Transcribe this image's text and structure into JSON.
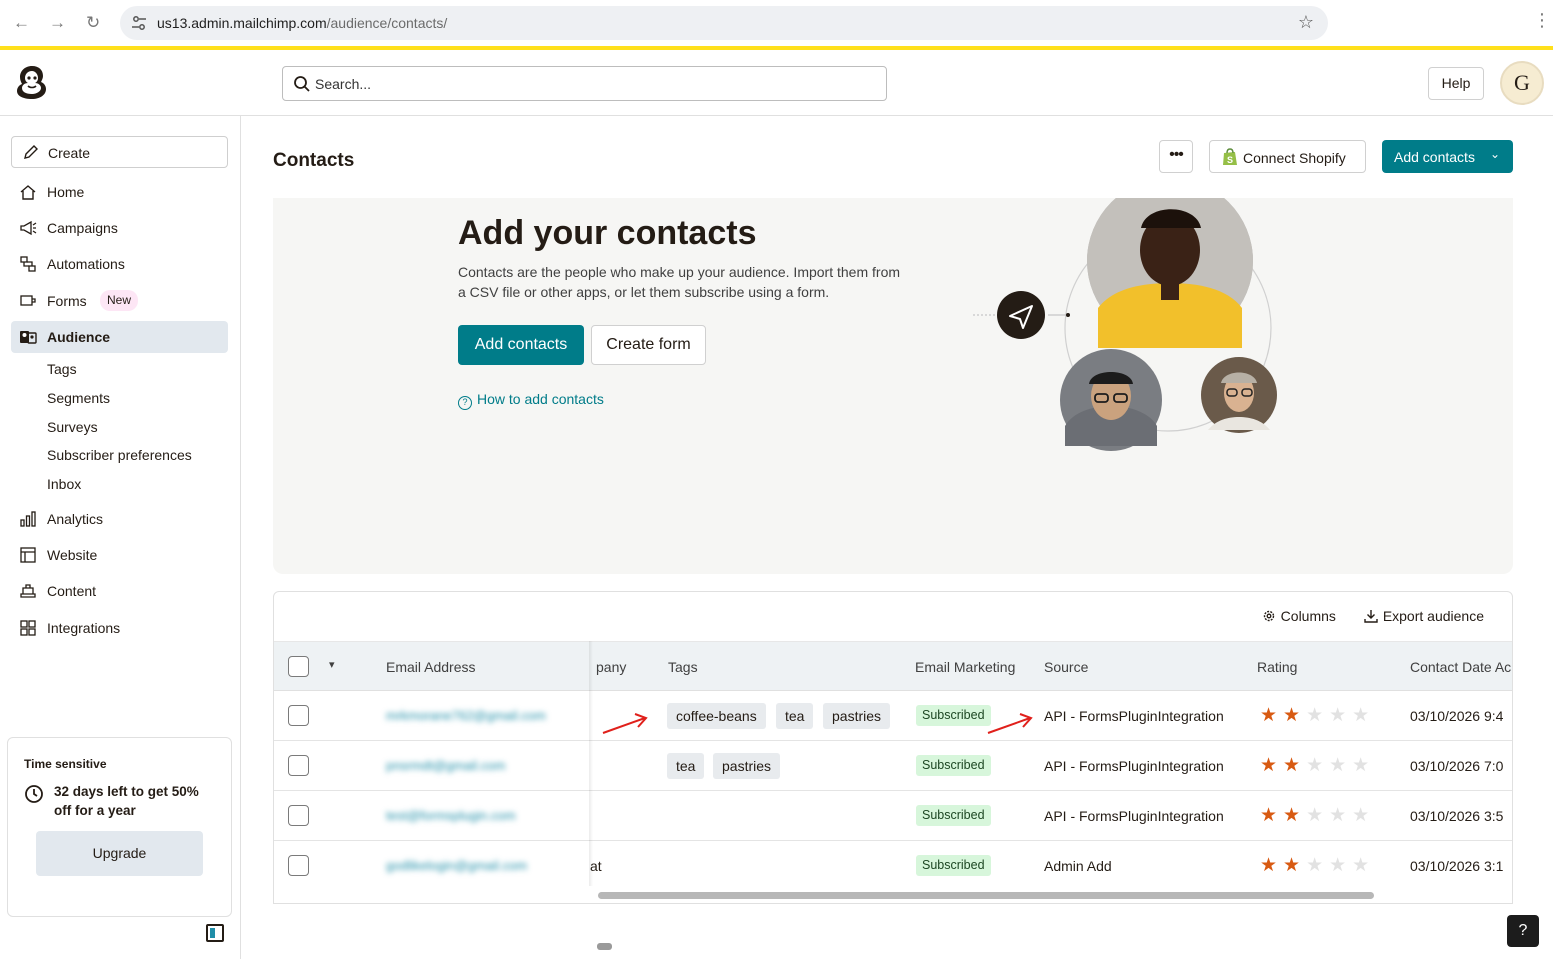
{
  "browser": {
    "url_host": "us13.admin.mailchimp.com",
    "url_path": "/audience/contacts/"
  },
  "header": {
    "search_placeholder": "Search...",
    "help_label": "Help",
    "avatar_letter": "G"
  },
  "sidebar": {
    "create_label": "Create",
    "items": [
      {
        "label": "Home",
        "icon": "home-icon"
      },
      {
        "label": "Campaigns",
        "icon": "megaphone-icon"
      },
      {
        "label": "Automations",
        "icon": "automation-icon"
      },
      {
        "label": "Forms",
        "icon": "forms-icon",
        "badge": "New"
      },
      {
        "label": "Audience",
        "icon": "audience-icon",
        "active": true
      },
      {
        "label": "Analytics",
        "icon": "bar-chart-icon"
      },
      {
        "label": "Website",
        "icon": "website-icon"
      },
      {
        "label": "Content",
        "icon": "content-icon"
      },
      {
        "label": "Integrations",
        "icon": "integrations-icon"
      }
    ],
    "audience_sub": [
      "Tags",
      "Segments",
      "Surveys",
      "Subscriber preferences",
      "Inbox"
    ],
    "promo": {
      "label": "Time sensitive",
      "message": "32 days left to get 50% off for a year",
      "button": "Upgrade"
    }
  },
  "main": {
    "title": "Contacts",
    "more_label": "•••",
    "shopify_label": "Connect Shopify",
    "add_contacts_label": "Add contacts",
    "hero": {
      "title": "Add your contacts",
      "description": "Contacts are the people who make up your audience. Import them from a CSV file or other apps, or let them subscribe using a form.",
      "primary_button": "Add contacts",
      "secondary_button": "Create form",
      "help_link": "How to add contacts"
    },
    "table": {
      "columns_label": "Columns",
      "export_label": "Export audience",
      "headers": {
        "email": "Email Address",
        "company": "pany",
        "tags": "Tags",
        "email_marketing": "Email Marketing",
        "source": "Source",
        "rating": "Rating",
        "contact_date": "Contact Date Ac"
      },
      "rows": [
        {
          "email": "mrkmorane762@gmail.com",
          "company": "",
          "tags": [
            "coffee-beans",
            "tea",
            "pastries"
          ],
          "status": "Subscribed",
          "source": "API - FormsPluginIntegration",
          "rating": 2,
          "date": "03/10/2026 9:4"
        },
        {
          "email": "pnsrmdt@gmail.com",
          "company": "",
          "tags": [
            "tea",
            "pastries"
          ],
          "status": "Subscribed",
          "source": "API - FormsPluginIntegration",
          "rating": 2,
          "date": "03/10/2026 7:0"
        },
        {
          "email": "test@formsplugin.com",
          "company": "",
          "tags": [],
          "status": "Subscribed",
          "source": "API - FormsPluginIntegration",
          "rating": 2,
          "date": "03/10/2026 3:5"
        },
        {
          "email": "godlikelogin@gmail.com",
          "company": "at",
          "tags": [],
          "status": "Subscribed",
          "source": "Admin Add",
          "rating": 2,
          "date": "03/10/2026 3:1"
        }
      ],
      "max_rating": 5
    }
  },
  "help_button": "?",
  "colors": {
    "accent": "#007c89",
    "brand_yellow": "#ffe01b",
    "star_on": "#d85a12",
    "subscribed_bg": "#d7f6db",
    "annotation_arrow": "#e0201b"
  }
}
